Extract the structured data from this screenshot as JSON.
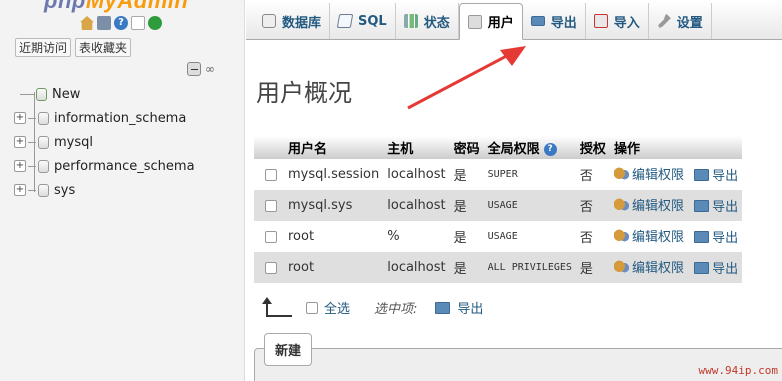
{
  "app": {
    "logo_main": "php",
    "logo_accent": "MyAdmin"
  },
  "nav": {
    "recent_tab": "近期访问",
    "favorites_tab": "表收藏夹",
    "tree": [
      {
        "label": "New",
        "type": "new"
      },
      {
        "label": "information_schema",
        "type": "db"
      },
      {
        "label": "mysql",
        "type": "db"
      },
      {
        "label": "performance_schema",
        "type": "db"
      },
      {
        "label": "sys",
        "type": "db"
      }
    ]
  },
  "tabs": [
    {
      "label": "数据库",
      "icon": "database-icon"
    },
    {
      "label": "SQL",
      "icon": "sql-icon"
    },
    {
      "label": "状态",
      "icon": "status-icon"
    },
    {
      "label": "用户",
      "icon": "users-icon",
      "active": true
    },
    {
      "label": "导出",
      "icon": "export-icon"
    },
    {
      "label": "导入",
      "icon": "import-icon"
    },
    {
      "label": "设置",
      "icon": "settings-icon"
    }
  ],
  "page_title": "用户概况",
  "table": {
    "headers": [
      "用户名",
      "主机",
      "密码",
      "全局权限",
      "授权",
      "操作"
    ],
    "rows": [
      {
        "user": "mysql.session",
        "host": "localhost",
        "password": "是",
        "privileges": "SUPER",
        "grant": "否",
        "edit": "编辑权限",
        "export": "导出"
      },
      {
        "user": "mysql.sys",
        "host": "localhost",
        "password": "是",
        "privileges": "USAGE",
        "grant": "否",
        "edit": "编辑权限",
        "export": "导出"
      },
      {
        "user": "root",
        "host": "%",
        "password": "是",
        "privileges": "USAGE",
        "grant": "否",
        "edit": "编辑权限",
        "export": "导出"
      },
      {
        "user": "root",
        "host": "localhost",
        "password": "是",
        "privileges": "ALL PRIVILEGES",
        "grant": "是",
        "edit": "编辑权限",
        "export": "导出"
      }
    ]
  },
  "bulk": {
    "select_all": "全选",
    "with_selected": "选中项:",
    "export": "导出"
  },
  "new_legend": "新建",
  "watermark": "www.94ip.com",
  "colors": {
    "link": "#235a81",
    "arrow": "#e53935",
    "row_alt": "#dfdfdf"
  }
}
